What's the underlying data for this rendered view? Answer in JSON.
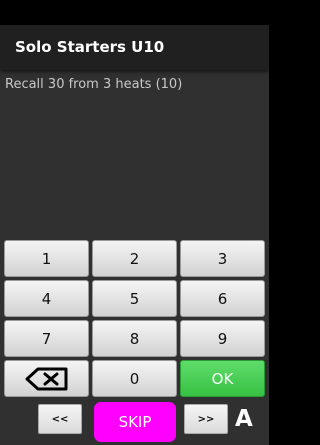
{
  "header": {
    "title": "Solo Starters U10"
  },
  "subtitle": "Recall 30 from 3 heats (10)",
  "keypad": {
    "rows": [
      [
        "1",
        "2",
        "3"
      ],
      [
        "4",
        "5",
        "6"
      ],
      [
        "7",
        "8",
        "9"
      ]
    ],
    "zero_label": "0",
    "ok_label": "OK",
    "backspace_icon": "backspace-icon"
  },
  "bottom": {
    "prev_label": "<<",
    "skip_label": "SKIP",
    "next_label": ">>",
    "letter": "A"
  },
  "colors": {
    "ok": "#3fc84b",
    "skip": "#ff00ff",
    "background": "#303030",
    "action_bar": "#202020"
  }
}
